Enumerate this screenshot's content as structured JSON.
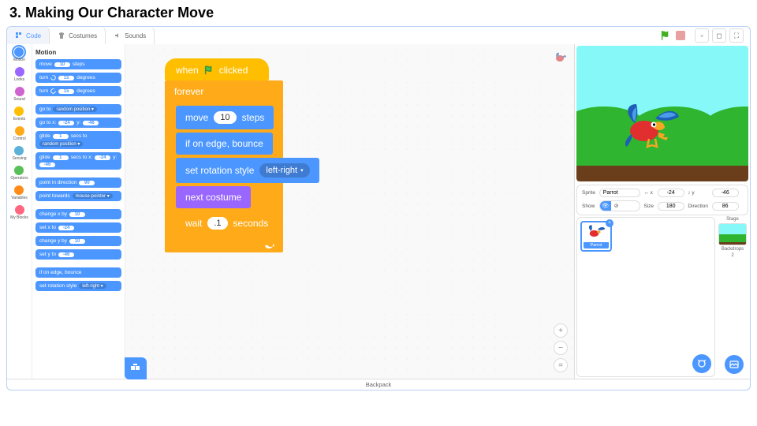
{
  "page_title": "3. Making Our Character Move",
  "tabs": {
    "code": "Code",
    "costumes": "Costumes",
    "sounds": "Sounds"
  },
  "categories": [
    {
      "name": "Motion",
      "color": "#4c97ff",
      "selected": true
    },
    {
      "name": "Looks",
      "color": "#9966ff"
    },
    {
      "name": "Sound",
      "color": "#cf63cf"
    },
    {
      "name": "Events",
      "color": "#ffbf00"
    },
    {
      "name": "Control",
      "color": "#ffab19"
    },
    {
      "name": "Sensing",
      "color": "#5cb1d6"
    },
    {
      "name": "Operators",
      "color": "#59c059"
    },
    {
      "name": "Variables",
      "color": "#ff8c1a"
    },
    {
      "name": "My Blocks",
      "color": "#ff6680"
    }
  ],
  "palette_header": "Motion",
  "palette_blocks": {
    "move": {
      "pre": "move",
      "val": "10",
      "post": "steps"
    },
    "turn_cw": {
      "pre": "turn",
      "val": "15",
      "post": "degrees"
    },
    "turn_ccw": {
      "pre": "turn",
      "val": "15",
      "post": "degrees"
    },
    "goto": {
      "pre": "go to",
      "dd": "random position ▾"
    },
    "gotoxy": {
      "pre": "go to x:",
      "x": "-24",
      "mid": "y:",
      "y": "-46"
    },
    "glide": {
      "pre": "glide",
      "sec": "1",
      "mid": "secs to",
      "dd": "random position ▾"
    },
    "glidexy": {
      "pre": "glide",
      "sec": "1",
      "mid": "secs to x:",
      "x": "-24",
      "mid2": "y:",
      "y": "-46"
    },
    "point_dir": {
      "pre": "point in direction",
      "val": "90"
    },
    "point_towards": {
      "pre": "point towards",
      "dd": "mouse-pointer ▾"
    },
    "change_x": {
      "pre": "change x by",
      "val": "10"
    },
    "set_x": {
      "pre": "set x to",
      "val": "-24"
    },
    "change_y": {
      "pre": "change y by",
      "val": "10"
    },
    "set_y": {
      "pre": "set y to",
      "val": "-46"
    },
    "edge_bounce": "if on edge, bounce",
    "rot_style": {
      "pre": "set rotation style",
      "dd": "left-right ▾"
    }
  },
  "script": {
    "hat": {
      "pre": "when",
      "post": "clicked"
    },
    "forever": "forever",
    "move": {
      "pre": "move",
      "val": "10",
      "post": "steps"
    },
    "bounce": "if on edge, bounce",
    "rot": {
      "pre": "set rotation style",
      "dd": "left-right",
      "tri": "▾"
    },
    "next_costume": "next costume",
    "wait": {
      "pre": "wait",
      "val": ".1",
      "post": "seconds"
    }
  },
  "sprite_panel": {
    "sprite_lbl": "Sprite",
    "name": "Parrot",
    "x_lbl": "x",
    "x": "-24",
    "y_lbl": "y",
    "y": "-46",
    "show_lbl": "Show",
    "size_lbl": "Size",
    "size": "180",
    "dir_lbl": "Direction",
    "dir": "86"
  },
  "stage_panel": {
    "stage_lbl": "Stage",
    "backdrops_lbl": "Backdrops",
    "backdrops_count": "2"
  },
  "sprite_card_name": "Parrot",
  "backpack": "Backpack"
}
